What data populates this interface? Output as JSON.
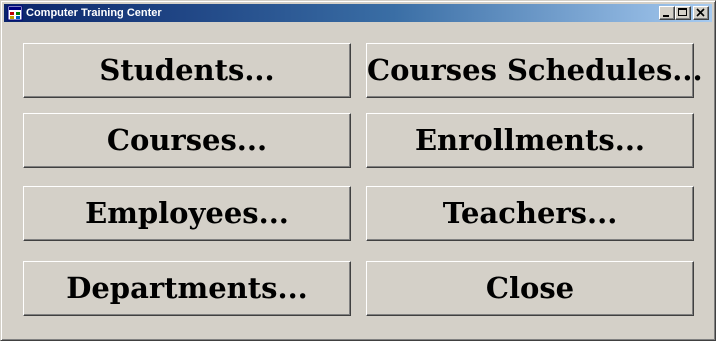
{
  "window": {
    "title": "Computer Training Center",
    "icon": "app-form-icon",
    "controls": {
      "minimize": "minimize-icon",
      "maximize": "maximize-icon",
      "close": "close-icon"
    }
  },
  "buttons": {
    "students": "Students...",
    "courses_schedules": "Courses Schedules...",
    "courses": "Courses...",
    "enrollments": "Enrollments...",
    "employees": "Employees...",
    "teachers": "Teachers...",
    "departments": "Departments...",
    "close": "Close"
  },
  "colors": {
    "face": "#d4d0c8",
    "titlebar_start": "#0a246a",
    "titlebar_end": "#a6caf0"
  }
}
